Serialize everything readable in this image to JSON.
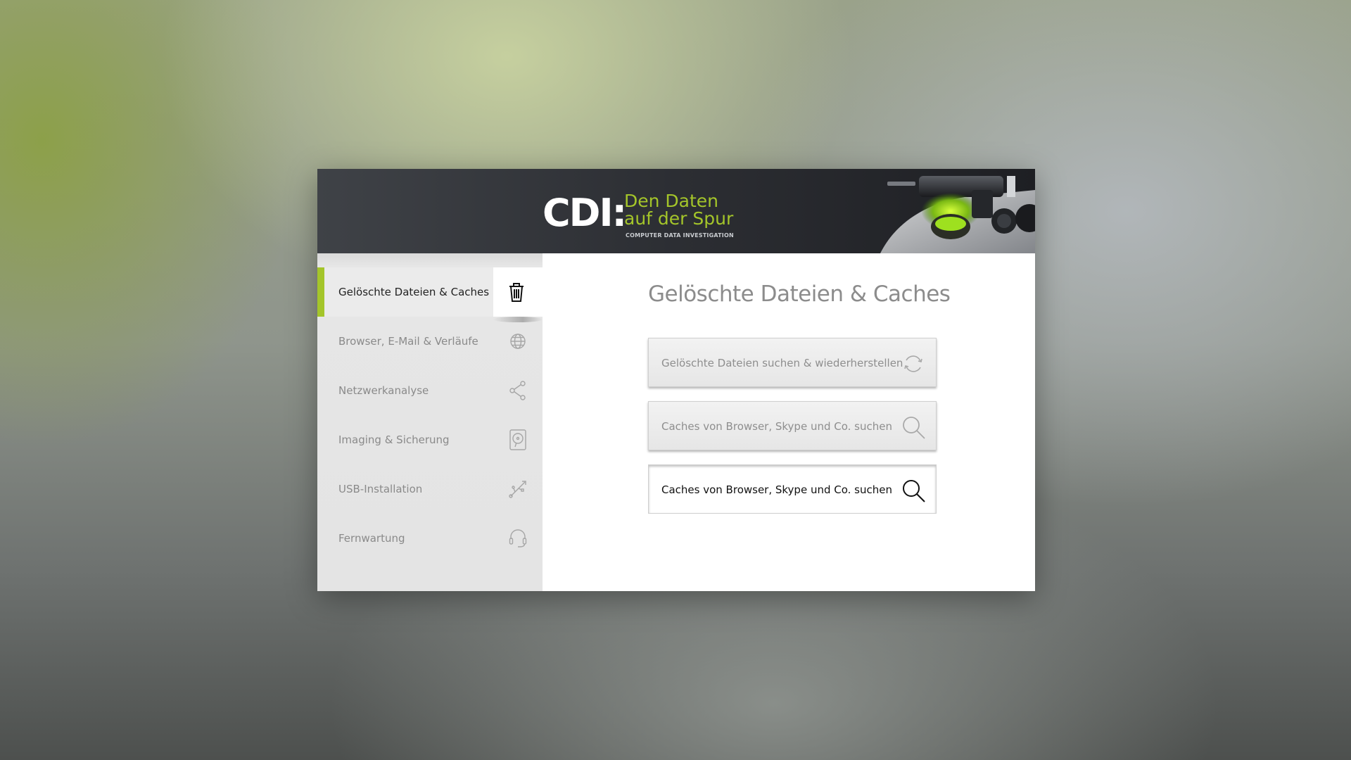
{
  "header": {
    "logo_text": "CDI:",
    "slogan_line1": "Den Daten",
    "slogan_line2": "auf der Spur",
    "subtitle": "COMPUTER DATA INVESTIGATION"
  },
  "sidebar": {
    "items": [
      {
        "label": "Gelöschte Dateien & Caches",
        "icon": "trash-icon",
        "active": true
      },
      {
        "label": "Browser, E-Mail & Verläufe",
        "icon": "globe-icon",
        "active": false
      },
      {
        "label": "Netzwerkanalyse",
        "icon": "share-network-icon",
        "active": false
      },
      {
        "label": "Imaging & Sicherung",
        "icon": "disk-image-icon",
        "active": false
      },
      {
        "label": "USB-Installation",
        "icon": "usb-icon",
        "active": false
      },
      {
        "label": "Fernwartung",
        "icon": "headset-icon",
        "active": false
      }
    ]
  },
  "main": {
    "title": "Gelöschte Dateien & Caches",
    "actions": [
      {
        "label": "Gelöschte Dateien suchen & wiederherstellen",
        "icon": "refresh-icon",
        "state": "normal"
      },
      {
        "label": "Caches von Browser, Skype und Co. suchen",
        "icon": "search-icon",
        "state": "normal"
      },
      {
        "label": "Caches von Browser, Skype und Co. suchen",
        "icon": "search-icon",
        "state": "hover"
      }
    ]
  },
  "colors": {
    "accent": "#a4c52a",
    "header_bg": "#2c2e33",
    "sidebar_bg": "#e4e4e4"
  }
}
